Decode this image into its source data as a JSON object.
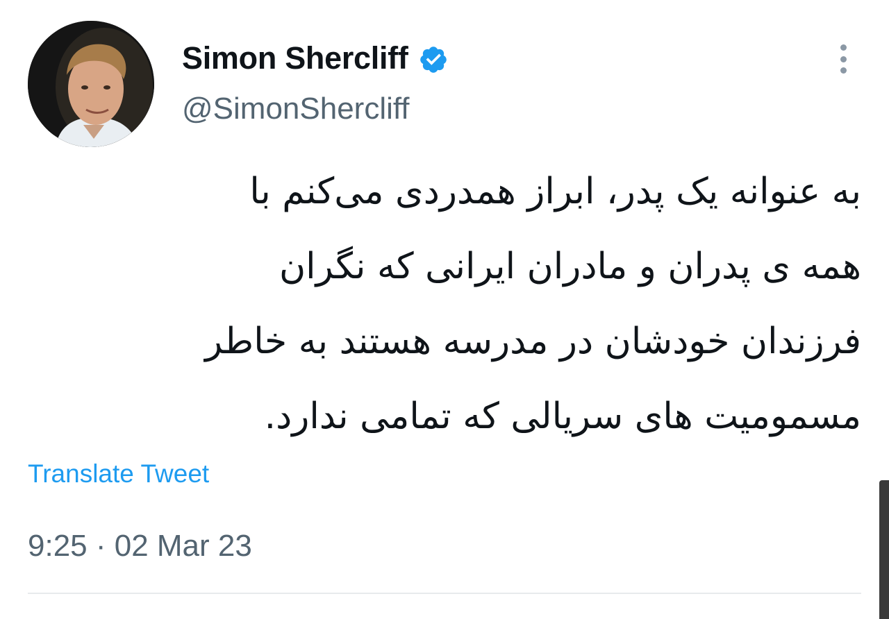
{
  "author": {
    "display_name": "Simon Shercliff",
    "handle": "@SimonShercliff",
    "verified": true,
    "avatar_icon": "profile-photo"
  },
  "tweet": {
    "lines": [
      "به عنوانه یک پدر، ابراز همدردی می‌کنم با",
      "همه ی پدران و مادران ایرانی که نگران",
      "فرزندان خودشان در مدرسه هستند به خاطر",
      "مسمومیت های سریالی که تمامی ندارد."
    ],
    "translate_label": "Translate Tweet",
    "timestamp": "9:25 · 02 Mar 23"
  },
  "colors": {
    "text_primary": "#0f1419",
    "text_secondary": "#536471",
    "accent": "#1d9bf0",
    "verified_badge": "#1d9bf0",
    "divider": "#e7eaec"
  },
  "icons": {
    "verified": "verified-badge-icon",
    "more": "more-vertical-icon"
  }
}
